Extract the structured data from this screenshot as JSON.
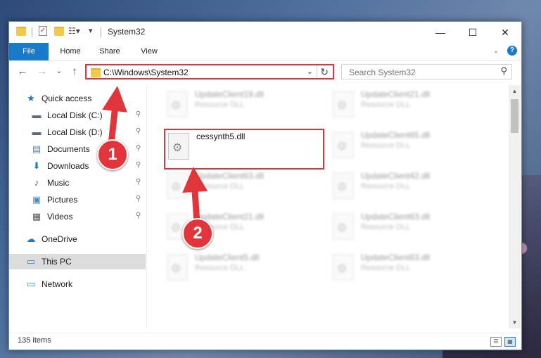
{
  "window": {
    "title": "System32",
    "controls": {
      "minimize": "—",
      "maximize": "☐",
      "close": "✕"
    }
  },
  "ribbon": {
    "tabs": [
      "File",
      "Home",
      "Share",
      "View"
    ],
    "help": "?"
  },
  "navigation": {
    "back": "←",
    "forward": "→",
    "recent": "⌄",
    "up": "↑",
    "address": "C:\\Windows\\System32",
    "dropdown": "⌄",
    "refresh": "↻",
    "search_placeholder": "Search System32",
    "search_icon": "⚲"
  },
  "sidebar": {
    "items": [
      {
        "label": "Quick access",
        "icon": "star-icon",
        "glyph": "★",
        "color": "#1979ca",
        "pinned": false
      },
      {
        "label": "Local Disk (C:)",
        "icon": "drive-icon",
        "glyph": "▬",
        "color": "#5b6b7b",
        "pinned": true
      },
      {
        "label": "Local Disk (D:)",
        "icon": "drive-icon",
        "glyph": "▬",
        "color": "#5b6b7b",
        "pinned": true
      },
      {
        "label": "Documents",
        "icon": "document-icon",
        "glyph": "▤",
        "color": "#5a7fa8",
        "pinned": true
      },
      {
        "label": "Downloads",
        "icon": "download-icon",
        "glyph": "⬇",
        "color": "#1979ca",
        "pinned": true
      },
      {
        "label": "Music",
        "icon": "music-icon",
        "glyph": "♪",
        "color": "#3a6ea5",
        "pinned": true
      },
      {
        "label": "Pictures",
        "icon": "pictures-icon",
        "glyph": "▣",
        "color": "#4a8bc9",
        "pinned": true
      },
      {
        "label": "Videos",
        "icon": "video-icon",
        "glyph": "▦",
        "color": "#555555",
        "pinned": true
      },
      {
        "label": "OneDrive",
        "icon": "cloud-icon",
        "glyph": "☁",
        "color": "#1979ca",
        "pinned": false
      },
      {
        "label": "This PC",
        "icon": "computer-icon",
        "glyph": "▭",
        "color": "#2f80c9",
        "pinned": false
      },
      {
        "label": "Network",
        "icon": "network-icon",
        "glyph": "▭",
        "color": "#2f80c9",
        "pinned": false
      }
    ],
    "pin_glyph": "📌"
  },
  "files": [
    {
      "name": "UpdateClient19.dll",
      "type": "Resource DLL",
      "blur": true
    },
    {
      "name": "UpdateClient21.dll",
      "type": "Resource DLL",
      "blur": true
    },
    {
      "name": "cessynth5.dll",
      "type": "",
      "blur": false
    },
    {
      "name": "UpdateClient65.dll",
      "type": "Resource DLL",
      "blur": true
    },
    {
      "name": "UpdateClient63.dll",
      "type": "Resource DLL",
      "blur": true
    },
    {
      "name": "UpdateClient42.dll",
      "type": "Resource DLL",
      "blur": true
    },
    {
      "name": "UpdateClient21.dll",
      "type": "Resource DLL",
      "blur": true
    },
    {
      "name": "UpdateClient63.dll",
      "type": "Resource DLL",
      "blur": true
    },
    {
      "name": "UpdateClient5.dll",
      "type": "Resource DLL",
      "blur": true
    },
    {
      "name": "UpdateClient63.dll",
      "type": "Resource DLL",
      "blur": true
    }
  ],
  "status": {
    "count": "135 items"
  },
  "annotations": {
    "step1": "1",
    "step2": "2",
    "color": "#e0353b"
  },
  "scroll": {
    "up": "▲",
    "down": "▼"
  }
}
